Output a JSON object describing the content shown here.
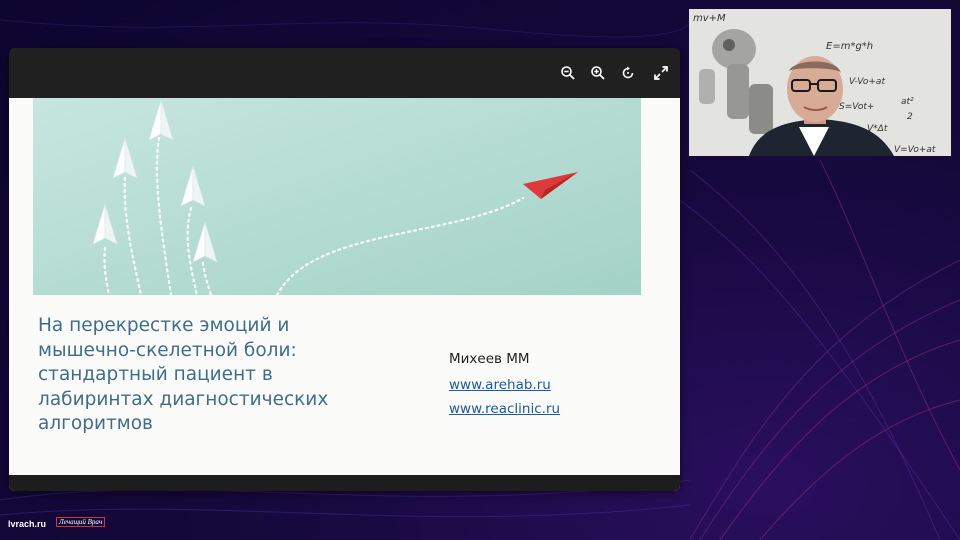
{
  "slide": {
    "title_lines": [
      "На перекрестке эмоций и",
      "мышечно-скелетной боли:",
      "стандартный пациент в",
      "лабиринтах диагностических",
      "алгоритмов"
    ],
    "author": "Михеев ММ",
    "links": [
      "www.arehab.ru",
      "www.reaclinic.ru"
    ]
  },
  "toolbar": {
    "icons": [
      "zoom-out-icon",
      "zoom-in-icon",
      "rotate-icon",
      "fullscreen-icon"
    ]
  },
  "webcam": {
    "whiteboard_formulas": [
      "mv+M",
      "E=m*g*h",
      "V-Vo+at",
      "S=Vot+",
      "at²",
      "2",
      "V*Δt",
      "V=Vo+at"
    ]
  },
  "footer": {
    "site": "lvrach.ru",
    "brand": "Лечащий Врач"
  },
  "colors": {
    "accent_plane": "#e0393b",
    "title": "#3f6e8b",
    "link": "#1a5aa8",
    "hero_bg": "#b4dcd3"
  }
}
